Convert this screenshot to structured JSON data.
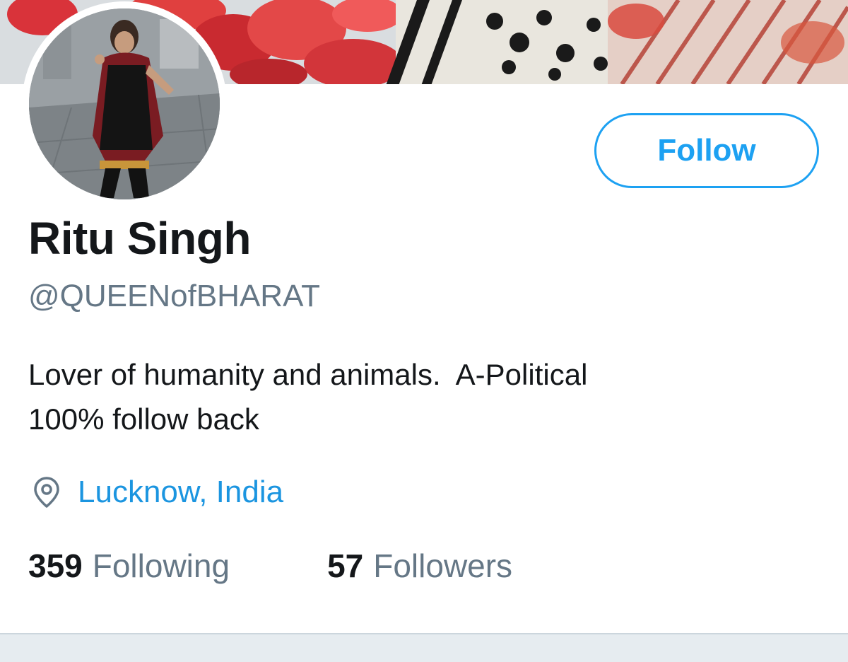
{
  "profile": {
    "display_name": "Ritu Singh",
    "handle": "@QUEENofBHARAT",
    "bio_lines": [
      "Lover of humanity and animals.  A-Political",
      "100% follow back"
    ],
    "location": "Lucknow, India",
    "following_count": "359",
    "following_label": "Following",
    "followers_count": "57",
    "followers_label": "Followers"
  },
  "actions": {
    "follow_label": "Follow"
  },
  "icons": {
    "location": "location-pin-icon"
  },
  "colors": {
    "accent": "#1da1f2",
    "link": "#1b95e0",
    "text_primary": "#14171a",
    "text_secondary": "#657786",
    "divider": "#e6ecf0"
  }
}
